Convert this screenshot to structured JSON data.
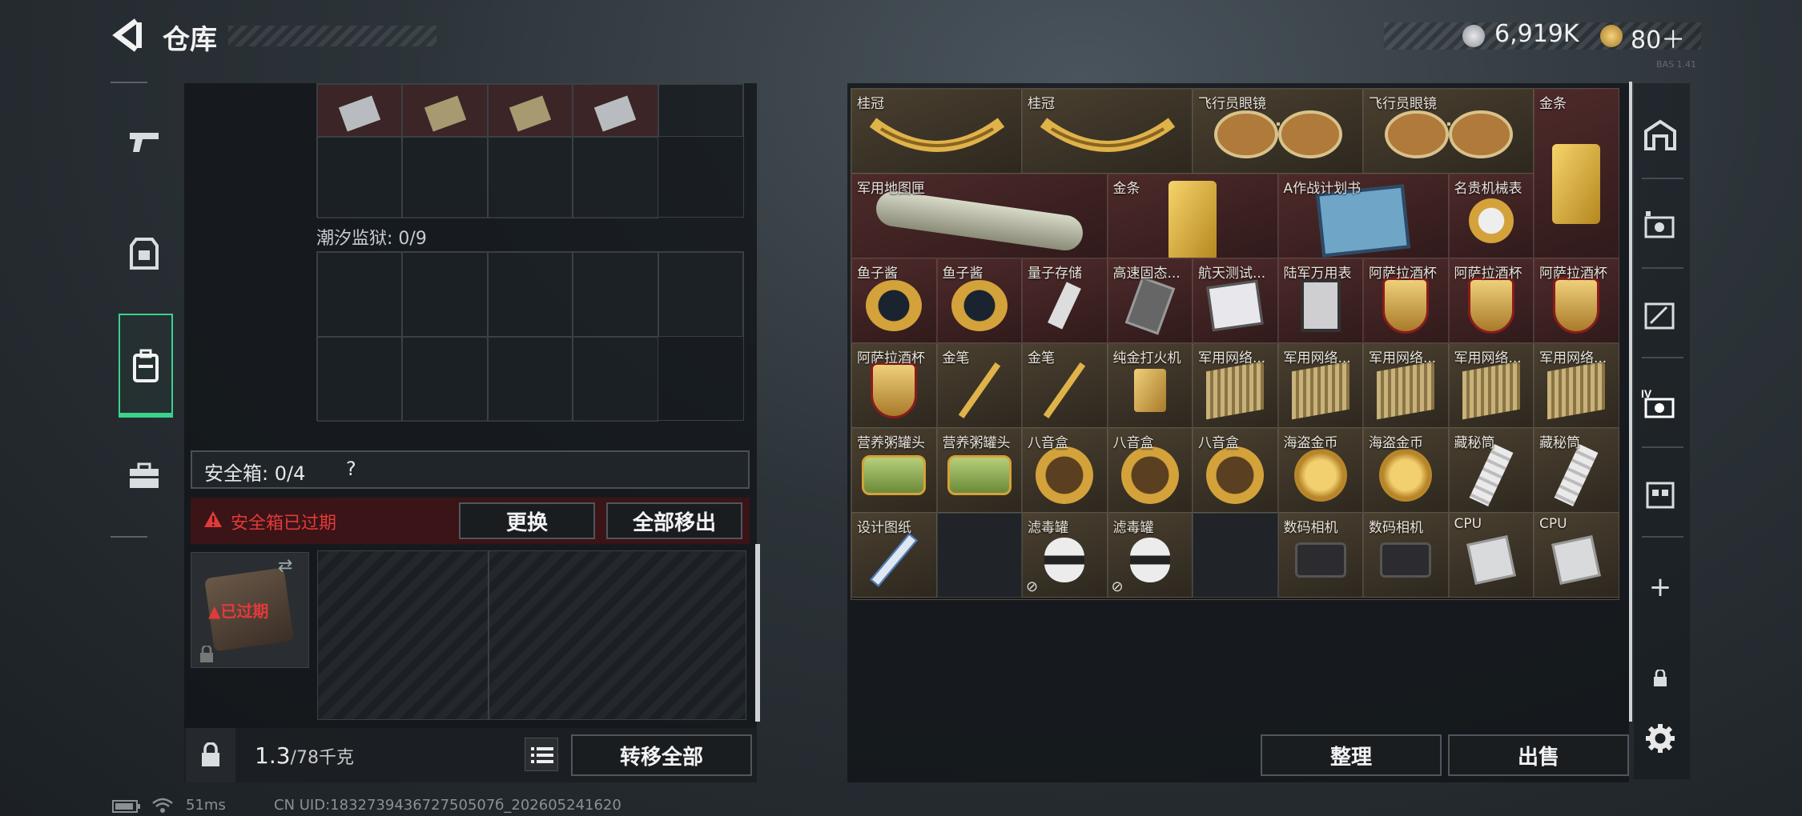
{
  "header": {
    "title": "仓库",
    "currency_a": "6,919K",
    "currency_b": "80＋",
    "tiny_text": "BAS 1.41"
  },
  "left_panel": {
    "prison_label": "潮汐监狱: 0/9",
    "safe_label": "安全箱:",
    "safe_count": "0/4",
    "safe_help": "?",
    "warning": "安全箱已过期",
    "replace_button": "更换",
    "move_all_out_button": "全部移出",
    "case_status": "已过期",
    "weight_current": "1.3",
    "weight_max": "/78千克",
    "transfer_all_button": "转移全部"
  },
  "inventory": {
    "items": [
      {
        "name": "桂冠",
        "icon": "laurel-crown-icon",
        "rarity": "gold"
      },
      {
        "name": "桂冠",
        "icon": "laurel-crown-icon",
        "rarity": "gold"
      },
      {
        "name": "飞行员眼镜",
        "icon": "aviator-sunglasses-icon",
        "rarity": "gold"
      },
      {
        "name": "飞行员眼镜",
        "icon": "aviator-sunglasses-icon",
        "rarity": "gold"
      },
      {
        "name": "金条",
        "icon": "gold-bar-icon",
        "rarity": "red"
      },
      {
        "name": "军用地图匣",
        "icon": "map-tube-icon",
        "rarity": "red"
      },
      {
        "name": "金条",
        "icon": "gold-bar-icon",
        "rarity": "red"
      },
      {
        "name": "A作战计划书",
        "icon": "battle-plan-icon",
        "rarity": "red"
      },
      {
        "name": "名贵机械表",
        "icon": "watch-icon",
        "rarity": "red"
      },
      {
        "name": "鱼子酱",
        "icon": "caviar-tin-icon",
        "rarity": "red"
      },
      {
        "name": "鱼子酱",
        "icon": "caviar-tin-icon",
        "rarity": "red"
      },
      {
        "name": "量子存储",
        "icon": "usb-drive-icon",
        "rarity": "red"
      },
      {
        "name": "高速固态...",
        "icon": "ssd-icon",
        "rarity": "red"
      },
      {
        "name": "航天测试...",
        "icon": "test-device-icon",
        "rarity": "red"
      },
      {
        "name": "陆军万用表",
        "icon": "multimeter-icon",
        "rarity": "red"
      },
      {
        "name": "阿萨拉酒杯",
        "icon": "goblet-icon",
        "rarity": "red"
      },
      {
        "name": "阿萨拉酒杯",
        "icon": "goblet-icon",
        "rarity": "red"
      },
      {
        "name": "阿萨拉酒杯",
        "icon": "goblet-icon",
        "rarity": "red"
      },
      {
        "name": "阿萨拉酒杯",
        "icon": "goblet-icon",
        "rarity": "gold"
      },
      {
        "name": "金笔",
        "icon": "gold-pen-icon",
        "rarity": "gold"
      },
      {
        "name": "金笔",
        "icon": "gold-pen-icon",
        "rarity": "gold"
      },
      {
        "name": "纯金打火机",
        "icon": "lighter-icon",
        "rarity": "gold"
      },
      {
        "name": "军用网络...",
        "icon": "network-module-icon",
        "rarity": "gold"
      },
      {
        "name": "军用网络...",
        "icon": "network-module-icon",
        "rarity": "gold"
      },
      {
        "name": "军用网络...",
        "icon": "network-module-icon",
        "rarity": "gold"
      },
      {
        "name": "军用网络...",
        "icon": "network-module-icon",
        "rarity": "gold"
      },
      {
        "name": "军用网络...",
        "icon": "network-module-icon",
        "rarity": "gold"
      },
      {
        "name": "营养粥罐头",
        "icon": "porridge-can-icon",
        "rarity": "gold"
      },
      {
        "name": "营养粥罐头",
        "icon": "porridge-can-icon",
        "rarity": "gold"
      },
      {
        "name": "八音盒",
        "icon": "music-box-icon",
        "rarity": "gold"
      },
      {
        "name": "八音盒",
        "icon": "music-box-icon",
        "rarity": "gold"
      },
      {
        "name": "八音盒",
        "icon": "music-box-icon",
        "rarity": "gold"
      },
      {
        "name": "海盗金币",
        "icon": "pirate-coin-icon",
        "rarity": "gold"
      },
      {
        "name": "海盗金币",
        "icon": "pirate-coin-icon",
        "rarity": "gold"
      },
      {
        "name": "藏秘筒",
        "icon": "cryptex-icon",
        "rarity": "gold"
      },
      {
        "name": "藏秘筒",
        "icon": "cryptex-icon",
        "rarity": "gold"
      },
      {
        "name": "设计图纸",
        "icon": "blueprint-icon",
        "rarity": "gold"
      },
      {
        "name": "滤毒罐",
        "icon": "filter-canister-icon",
        "rarity": "gold"
      },
      {
        "name": "滤毒罐",
        "icon": "filter-canister-icon",
        "rarity": "gold"
      },
      {
        "name": "数码相机",
        "icon": "camera-icon",
        "rarity": "gold"
      },
      {
        "name": "数码相机",
        "icon": "camera-icon",
        "rarity": "gold"
      },
      {
        "name": "CPU",
        "icon": "cpu-icon",
        "rarity": "gold"
      },
      {
        "name": "CPU",
        "icon": "cpu-icon",
        "rarity": "gold"
      }
    ]
  },
  "right_buttons": {
    "organize": "整理",
    "sell": "出售"
  },
  "status_bar": {
    "ping": "51ms",
    "uid": "CN UID:183273943672750507б_202605241620"
  },
  "colors": {
    "accent_green": "#3bd28c",
    "warning_red": "#e23a3a",
    "rarity_gold": "#4a4030",
    "rarity_red": "#4e2a2a"
  }
}
